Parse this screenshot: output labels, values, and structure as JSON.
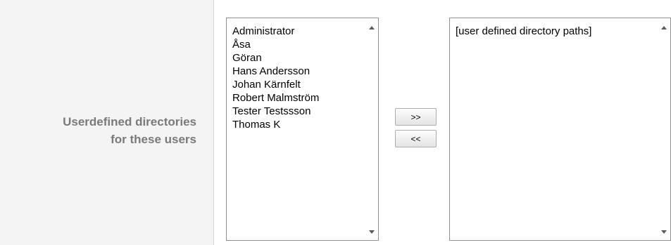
{
  "field": {
    "label_line1": "Userdefined directories",
    "label_line2": "for these users"
  },
  "users_list": {
    "items": [
      "Administrator",
      "Åsa",
      "Göran",
      "Hans Andersson",
      "Johan Kärnfelt",
      "Robert Malmström",
      "Tester Testssson",
      "Thomas K"
    ]
  },
  "buttons": {
    "add_label": ">>",
    "remove_label": "<<"
  },
  "paths_list": {
    "items": [
      "[user defined directory paths]"
    ]
  }
}
